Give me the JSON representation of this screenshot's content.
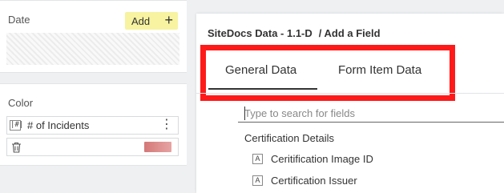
{
  "left": {
    "date": {
      "title": "Date",
      "add_label": "Add"
    },
    "color": {
      "title": "Color",
      "measure_badge": "#",
      "measure_label": "# of Incidents",
      "swatch_color": "#d47878"
    }
  },
  "dialog": {
    "breadcrumb": {
      "source": "SiteDocs Data - 1.1-D",
      "page": "/ Add a Field"
    },
    "tabs": [
      {
        "label": "General Data",
        "active": true
      },
      {
        "label": "Form Item Data",
        "active": false
      }
    ],
    "highlight_color": "#ff1a1a",
    "search": {
      "value": "",
      "placeholder": "Type to search for fields"
    },
    "section": "Certification Details",
    "fields": [
      {
        "badge": "A",
        "label": "Ceritification Image ID"
      },
      {
        "badge": "A",
        "label": "Certification Issuer"
      }
    ]
  }
}
